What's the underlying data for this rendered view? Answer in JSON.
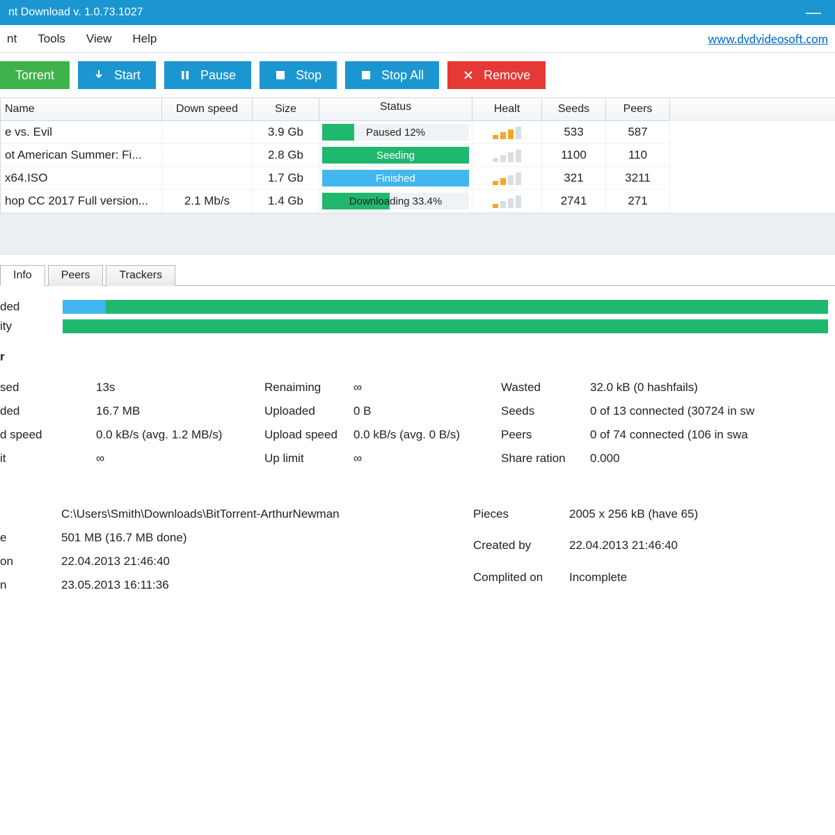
{
  "titlebar": {
    "title": "nt Download v. 1.0.73.1027"
  },
  "menubar": {
    "items": [
      "nt",
      "Tools",
      "View",
      "Help"
    ],
    "site_link": "www.dvdvideosoft.com"
  },
  "toolbar": {
    "torrent": "Torrent",
    "start": "Start",
    "pause": "Pause",
    "stop": "Stop",
    "stopall": "Stop All",
    "remove": "Remove"
  },
  "grid": {
    "headers": {
      "name": "Name",
      "down": "Down speed",
      "size": "Size",
      "status": "Status",
      "health": "Healt",
      "seeds": "Seeds",
      "peers": "Peers"
    },
    "rows": [
      {
        "name": "e vs. Evil",
        "down": "",
        "size": "3.9 Gb",
        "status_label": "Paused 12%",
        "fill_pct": 22,
        "fill_class": "fill-green",
        "lbl_class": "",
        "health": 3,
        "seeds": "533",
        "peers": "587"
      },
      {
        "name": "ot American Summer: Fi...",
        "down": "",
        "size": "2.8 Gb",
        "status_label": "Seeding",
        "fill_pct": 100,
        "fill_class": "fill-green",
        "lbl_class": "lbl-white",
        "health": 0,
        "seeds": "1100",
        "peers": "110"
      },
      {
        "name": " x64.ISO",
        "down": "",
        "size": "1.7 Gb",
        "status_label": "Finished",
        "fill_pct": 100,
        "fill_class": "fill-blue",
        "lbl_class": "lbl-white",
        "health": 2,
        "seeds": "321",
        "peers": "3211"
      },
      {
        "name": "hop CC 2017 Full version...",
        "down": "2.1 Mb/s",
        "size": "1.4 Gb",
        "status_label": "Downloading 33.4%",
        "fill_pct": 46,
        "fill_class": "fill-green",
        "lbl_class": "",
        "health": 1,
        "seeds": "2741",
        "peers": "271"
      }
    ]
  },
  "tabs": {
    "info": "Info",
    "peers": "Peers",
    "trackers": "Trackers"
  },
  "infobars": {
    "downloaded_label": "ded",
    "availability_label": "ity"
  },
  "transfer": {
    "heading": "r",
    "left": {
      "elapsed_k": "sed",
      "elapsed_v": "13s",
      "downloaded_k": "ded",
      "downloaded_v": "16.7 MB",
      "dspeed_k": "d speed",
      "dspeed_v": "0.0 kB/s (avg. 1.2 MB/s)",
      "limit_k": "it",
      "limit_v": "∞"
    },
    "mid": {
      "remaining_k": "Renaiming",
      "remaining_v": "∞",
      "uploaded_k": "Uploaded",
      "uploaded_v": "0 B",
      "uspeed_k": "Upload speed",
      "uspeed_v": "0.0 kB/s (avg. 0 B/s)",
      "ulimit_k": "Up limit",
      "ulimit_v": "∞"
    },
    "right": {
      "wasted_k": "Wasted",
      "wasted_v": "32.0 kB (0 hashfails)",
      "seeds_k": "Seeds",
      "seeds_v": "0 of 13 connected (30724 in sw",
      "peers_k": "Peers",
      "peers_v": "0 of 74 connected (106 in swa",
      "share_k": "Share ration",
      "share_v": "0.000"
    }
  },
  "torrent_info": {
    "left": {
      "path_k": "",
      "path_v": "C:\\Users\\Smith\\Downloads\\BitTorrent-ArthurNewman",
      "size_k": "e",
      "size_v": "501 MB (16.7 MB done)",
      "created_k": "on",
      "created_v": "22.04.2013 21:46:40",
      "added_k": "n",
      "added_v": "23.05.2013 16:11:36"
    },
    "right": {
      "pieces_k": "Pieces",
      "pieces_v": "2005 x 256 kB (have 65)",
      "createdby_k": "Created by",
      "createdby_v": "22.04.2013 21:46:40",
      "completed_k": "Complited on",
      "completed_v": "Incomplete"
    }
  }
}
